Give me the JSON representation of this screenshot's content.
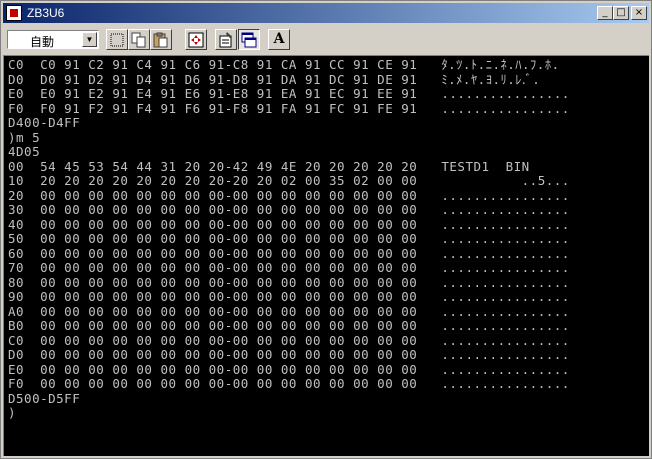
{
  "window": {
    "title": "ZB3U6"
  },
  "title_buttons": {
    "minimize": "_",
    "maximize": "□",
    "close": "×"
  },
  "toolbar": {
    "mode_value": "自動",
    "tools": [
      {
        "name": "select-tool",
        "icon": "dotted-rect-icon"
      },
      {
        "name": "copy-tool",
        "icon": "copy-icon"
      },
      {
        "name": "paste-tool",
        "icon": "paste-icon"
      },
      {
        "name": "fullscreen-tool",
        "icon": "move-icon"
      },
      {
        "name": "properties-tool",
        "icon": "properties-icon"
      },
      {
        "name": "background-tool",
        "icon": "window-icon"
      },
      {
        "name": "font-tool",
        "icon": "font-icon",
        "label": "A"
      }
    ]
  },
  "console": {
    "lines": [
      "C0  C0 91 C2 91 C4 91 C6 91-C8 91 CA 91 CC 91 CE 91   ﾀ.ﾂ.ﾄ.ﾆ.ﾈ.ﾊ.ﾌ.ﾎ.",
      "D0  D0 91 D2 91 D4 91 D6 91-D8 91 DA 91 DC 91 DE 91   ﾐ.ﾒ.ﾔ.ﾖ.ﾘ.ﾚ.ﾞ.",
      "E0  E0 91 E2 91 E4 91 E6 91-E8 91 EA 91 EC 91 EE 91   ................",
      "F0  F0 91 F2 91 F4 91 F6 91-F8 91 FA 91 FC 91 FE 91   ................",
      "D400-D4FF",
      ")m 5",
      "4D05",
      "00  54 45 53 54 44 31 20 20-42 49 4E 20 20 20 20 20   TESTD1  BIN",
      "10  20 20 20 20 20 20 20 20-20 20 02 00 35 02 00 00             ..5...",
      "20  00 00 00 00 00 00 00 00-00 00 00 00 00 00 00 00   ................",
      "30  00 00 00 00 00 00 00 00-00 00 00 00 00 00 00 00   ................",
      "40  00 00 00 00 00 00 00 00-00 00 00 00 00 00 00 00   ................",
      "50  00 00 00 00 00 00 00 00-00 00 00 00 00 00 00 00   ................",
      "60  00 00 00 00 00 00 00 00-00 00 00 00 00 00 00 00   ................",
      "70  00 00 00 00 00 00 00 00-00 00 00 00 00 00 00 00   ................",
      "80  00 00 00 00 00 00 00 00-00 00 00 00 00 00 00 00   ................",
      "90  00 00 00 00 00 00 00 00-00 00 00 00 00 00 00 00   ................",
      "A0  00 00 00 00 00 00 00 00-00 00 00 00 00 00 00 00   ................",
      "B0  00 00 00 00 00 00 00 00-00 00 00 00 00 00 00 00   ................",
      "C0  00 00 00 00 00 00 00 00-00 00 00 00 00 00 00 00   ................",
      "D0  00 00 00 00 00 00 00 00-00 00 00 00 00 00 00 00   ................",
      "E0  00 00 00 00 00 00 00 00-00 00 00 00 00 00 00 00   ................",
      "F0  00 00 00 00 00 00 00 00-00 00 00 00 00 00 00 00   ................",
      "D500-D5FF",
      ")"
    ]
  }
}
